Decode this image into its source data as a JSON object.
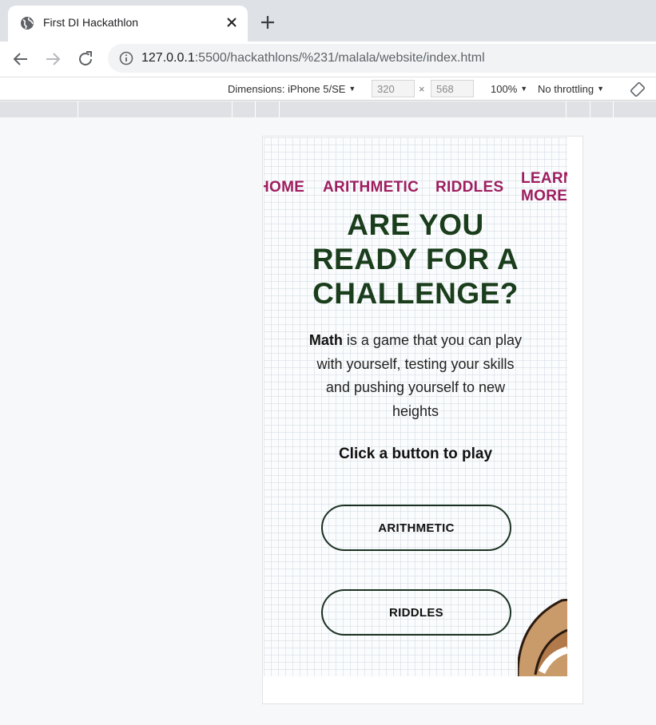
{
  "browser": {
    "tab": {
      "title": "First DI Hackathlon"
    },
    "url": {
      "host": "127.0.0.1",
      "rest": ":5500/hackathlons/%231/malala/website/index.html"
    }
  },
  "devtools": {
    "device": "Dimensions: iPhone 5/SE",
    "width": "320",
    "times": "×",
    "height": "568",
    "zoom": "100%",
    "throttling": "No throttling"
  },
  "site": {
    "nav": {
      "home": "HOME",
      "arithmetic": "ARITHMETIC",
      "riddles": "RIDDLES",
      "learn_more_line1": "LEARN",
      "learn_more_line2": "MORE"
    },
    "headline": [
      "ARE YOU",
      "READY FOR A",
      "CHALLENGE?"
    ],
    "intro_bold": "Math",
    "intro_rest": " is a game that you can play with yourself, testing your skills and pushing yourself to new heights",
    "cta": "Click a button to play",
    "buttons": {
      "arithmetic": "ARITHMETIC",
      "riddles": "RIDDLES"
    }
  },
  "icons": {
    "tab": "globe-icon",
    "close": "close-icon",
    "new_tab": "plus-icon",
    "back": "back-arrow-icon",
    "forward": "forward-arrow-icon",
    "reload": "reload-icon",
    "info": "info-icon",
    "rotate": "rotate-icon"
  },
  "colors": {
    "nav": "#9e1d5f",
    "headline": "#1a3d1c",
    "button_border": "#1a3020"
  }
}
